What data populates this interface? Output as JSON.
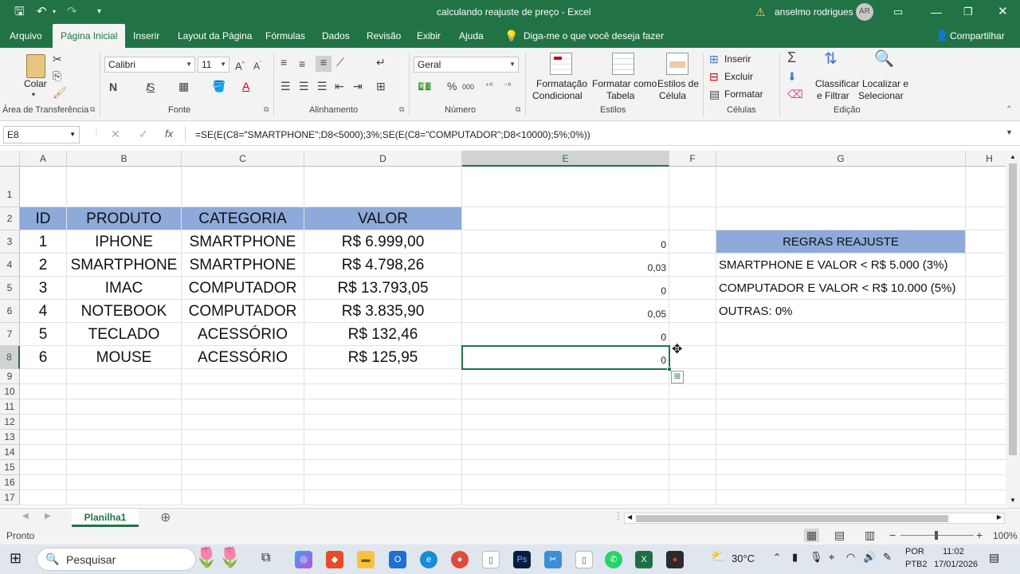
{
  "titlebar": {
    "title": "calculando reajuste de preço  -  Excel",
    "user_name": "anselmo rodrigues",
    "user_initials": "AR",
    "warning": "⚠"
  },
  "ribbon_tabs": [
    "Arquivo",
    "Página Inicial",
    "Inserir",
    "Layout da Página",
    "Fórmulas",
    "Dados",
    "Revisão",
    "Exibir",
    "Ajuda"
  ],
  "tell_me": "Diga-me o que você deseja fazer",
  "share": "Compartilhar",
  "ribbon": {
    "paste_label": "Colar",
    "font_name": "Calibri",
    "font_size": "11",
    "number_format": "Geral",
    "cond_format": "Formatação",
    "cond_format2": "Condicional",
    "format_table": "Formatar como",
    "format_table2": "Tabela",
    "cell_styles": "Estilos de",
    "cell_styles2": "Célula",
    "insert": "Inserir",
    "delete": "Excluir",
    "format": "Formatar",
    "sort": "Classificar",
    "sort2": "e Filtrar",
    "find": "Localizar e",
    "find2": "Selecionar",
    "groups": {
      "clipboard": "Área de Transferência",
      "font": "Fonte",
      "alignment": "Alinhamento",
      "number": "Número",
      "styles": "Estilos",
      "cells": "Células",
      "editing": "Edição"
    }
  },
  "formula_bar": {
    "name_box": "E8",
    "formula": "=SE(E(C8=\"SMARTPHONE\";D8<5000);3%;SE(E(C8=\"COMPUTADOR\";D8<10000);5%;0%))"
  },
  "columns": [
    "A",
    "B",
    "C",
    "D",
    "E",
    "F",
    "G",
    "H"
  ],
  "rows": [
    "1",
    "2",
    "3",
    "4",
    "5",
    "6",
    "7",
    "8",
    "9",
    "10",
    "11",
    "12",
    "13",
    "14",
    "15",
    "16",
    "17"
  ],
  "table": {
    "headers": [
      "ID",
      "PRODUTO",
      "CATEGORIA",
      "VALOR"
    ],
    "rows": [
      [
        "1",
        "IPHONE",
        "SMARTPHONE",
        "R$ 6.999,00",
        "0"
      ],
      [
        "2",
        "SMARTPHONE",
        "SMARTPHONE",
        "R$ 4.798,26",
        "0,03"
      ],
      [
        "3",
        "IMAC",
        "COMPUTADOR",
        "R$ 13.793,05",
        "0"
      ],
      [
        "4",
        "NOTEBOOK",
        "COMPUTADOR",
        "R$ 3.835,90",
        "0,05"
      ],
      [
        "5",
        "TECLADO",
        "ACESSÓRIO",
        "R$ 132,46",
        "0"
      ],
      [
        "6",
        "MOUSE",
        "ACESSÓRIO",
        "R$ 125,95",
        "0"
      ]
    ]
  },
  "rules": {
    "title": "REGRAS REAJUSTE",
    "lines": [
      "SMARTPHONE E VALOR < R$ 5.000 (3%)",
      "COMPUTADOR E VALOR < R$ 10.000 (5%)",
      "OUTRAS: 0%"
    ]
  },
  "sheet_tab": "Planilha1",
  "status": {
    "ready": "Pronto",
    "zoom": "100%"
  },
  "taskbar": {
    "search": "Pesquisar",
    "temperature": "30°C",
    "lang1": "POR",
    "lang2": "PTB2",
    "time": "11:02",
    "date": "17/01/2026"
  },
  "colors": {
    "excel_green": "#217346",
    "header_fill": "#8eaadb"
  }
}
